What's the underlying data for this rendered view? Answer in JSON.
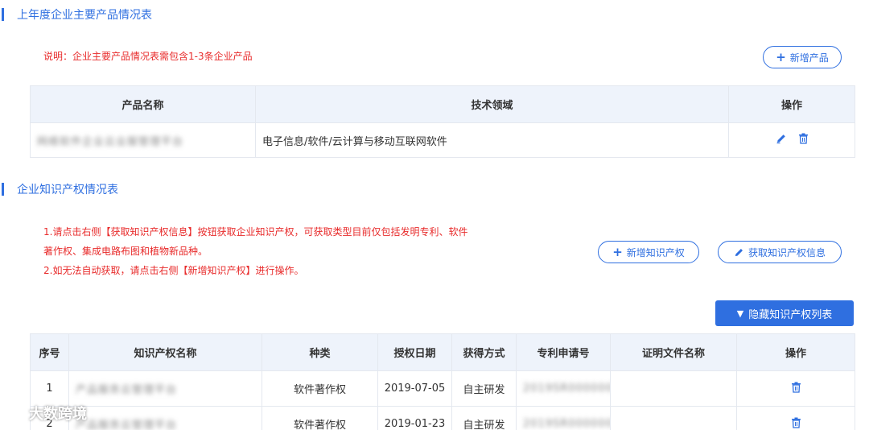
{
  "products": {
    "title": "上年度企业主要产品情况表",
    "note": "说明：企业主要产品情况表需包含1-3条企业产品",
    "add_button": "新增产品",
    "columns": [
      "产品名称",
      "技术领域",
      "操作"
    ],
    "rows": [
      {
        "name": "网络软件企业云业服管理平台",
        "field": "电子信息/软件/云计算与移动互联网软件"
      }
    ]
  },
  "ip": {
    "title": "企业知识产权情况表",
    "note_line1": "1.请点击右侧【获取知识产权信息】按钮获取企业知识产权，可获取类型目前仅包括发明专利、软件",
    "note_line2": "著作权、集成电路布图和植物新品种。",
    "note_line3": "2.如无法自动获取，请点击右侧【新增知识产权】进行操作。",
    "add_button": "新增知识产权",
    "fetch_button": "获取知识产权信息",
    "hide_button": "隐藏知识产权列表",
    "columns": [
      "序号",
      "知识产权名称",
      "种类",
      "授权日期",
      "获得方式",
      "专利申请号",
      "证明文件名称",
      "操作"
    ],
    "rows": [
      {
        "index": "1",
        "name": "产品服务云管理平台",
        "type": "软件著作权",
        "date": "2019-07-05",
        "method": "自主研发",
        "appno": "2019SR0000000"
      },
      {
        "index": "2",
        "name": "产品服务云管理平台",
        "type": "软件著作权",
        "date": "2019-01-23",
        "method": "自主研发",
        "appno": "2019SR0000000"
      }
    ]
  },
  "watermark": "大数跨境",
  "colors": {
    "accent": "#2f6fe0",
    "note": "#e82b2b",
    "header_bg": "#eef3fb"
  }
}
